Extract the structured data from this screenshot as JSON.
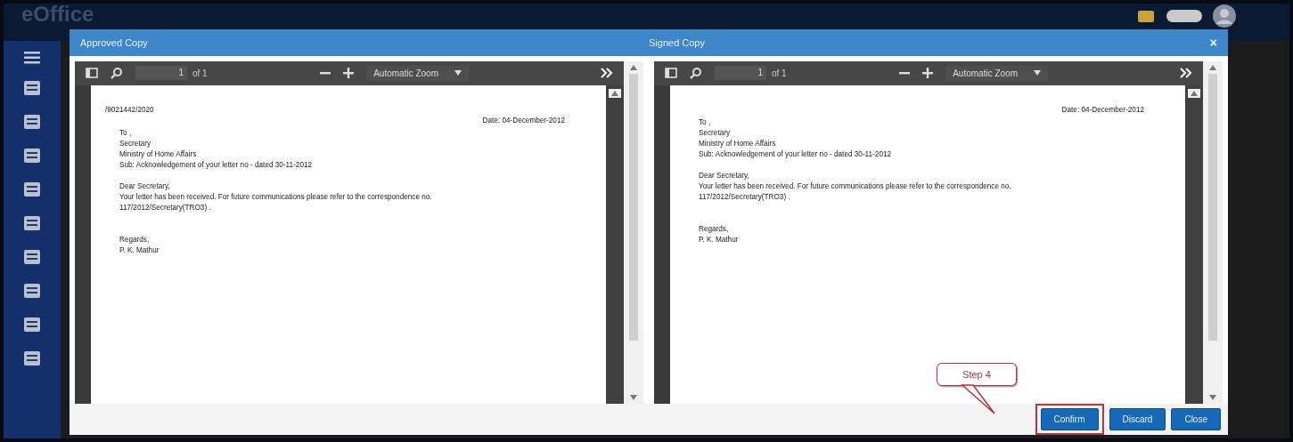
{
  "app": {
    "logo": "eOffice"
  },
  "dialog": {
    "close_icon": "×",
    "panes": [
      {
        "title": "Approved Copy",
        "viewer": {
          "page": "1",
          "page_count": "of 1",
          "zoom": "Automatic Zoom"
        },
        "letter": {
          "reference": "/9021442/2020",
          "date": "Date: 04-December-2012",
          "blocks": [
            [
              "To ,",
              "Secretary",
              "Ministry of Home Affairs",
              "Sub: Acknowledgement of your letter no - dated 30-11-2012"
            ],
            [
              "Dear Secretary,",
              "Your letter has been received. For future communications please refer to the correspondence no.",
              "117/2012/Secretary(TRO3) ."
            ],
            [
              "Regards,",
              "P. K. Mathur"
            ]
          ]
        }
      },
      {
        "title": "Signed Copy",
        "viewer": {
          "page": "1",
          "page_count": "of 1",
          "zoom": "Automatic Zoom"
        },
        "letter": {
          "date": "Date: 04-December-2012",
          "blocks": [
            [
              "To ,",
              "Secretary",
              "Ministry of Home Affairs",
              "Sub: Acknowledgement of your letter no - dated 30-11-2012"
            ],
            [
              "Dear Secretary,",
              "Your letter has been received. For future communications please refer to the correspondence no.",
              "117/2012/Secretary(TRO3) ."
            ],
            [
              "Regards,",
              "P. K. Mathur"
            ]
          ]
        }
      }
    ],
    "buttons": [
      {
        "label": "Confirm",
        "annotated": true
      },
      {
        "label": "Discard",
        "annotated": false
      },
      {
        "label": "Close",
        "annotated": false
      }
    ],
    "callout": {
      "text": "Step 4"
    }
  }
}
